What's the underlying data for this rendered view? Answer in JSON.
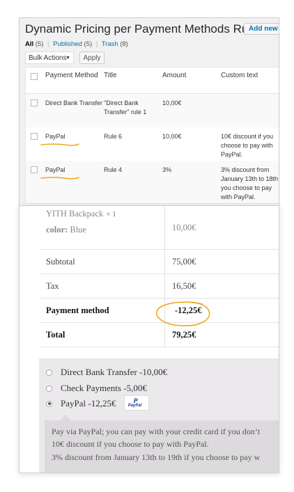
{
  "admin": {
    "title": "Dynamic Pricing per Payment Methods Rules",
    "add_new": "Add new",
    "filters": {
      "all": "All",
      "all_count": "(5)",
      "published": "Published",
      "published_count": "(5)",
      "trash": "Trash",
      "trash_count": "(8)",
      "separator": "|"
    },
    "bulk_actions": "Bulk Actions",
    "apply": "Apply",
    "columns": [
      "Payment Method",
      "Title",
      "Amount",
      "Custom text"
    ],
    "rows": [
      {
        "method": "Direct Bank Transfer",
        "title": "\"Direct Bank Transfer\" rule 1",
        "amount": "10,00€",
        "custom": ""
      },
      {
        "method": "PayPal",
        "title": "Rule 6",
        "amount": "10,00€",
        "custom": "10€ discount if you choose to pay with PayPal."
      },
      {
        "method": "PayPal",
        "title": "Rule 4",
        "amount": "3%",
        "custom": "3% discount from January 13th to 18th if you choose to pay with PayPal."
      }
    ]
  },
  "checkout": {
    "product_name": "YITH Backpack",
    "product_qty": "× 1",
    "color_label": "color:",
    "color_value": "Blue",
    "product_price": "10,00€",
    "subtotal_label": "Subtotal",
    "subtotal": "75,00€",
    "tax_label": "Tax",
    "tax": "16,50€",
    "payment_label": "Payment method",
    "payment_value": "-12,25€",
    "total_label": "Total",
    "total": "79,25€",
    "methods": [
      {
        "label": "Direct Bank Transfer -10,00€",
        "selected": false
      },
      {
        "label": "Check Payments -5,00€",
        "selected": false
      },
      {
        "label": "PayPal -12,25€",
        "selected": true
      }
    ],
    "paypal_logo_text": "PayPal",
    "desc_lines": [
      "Pay via PayPal; you can pay with your credit card if you don’t",
      "10€ discount if you choose to pay with PayPal.",
      "3% discount from January 13th to 19th if you choose to pay w"
    ]
  },
  "colors": {
    "highlight": "#f0a81c",
    "wp_link": "#0073aa",
    "paypal": "#1a3f8f"
  }
}
